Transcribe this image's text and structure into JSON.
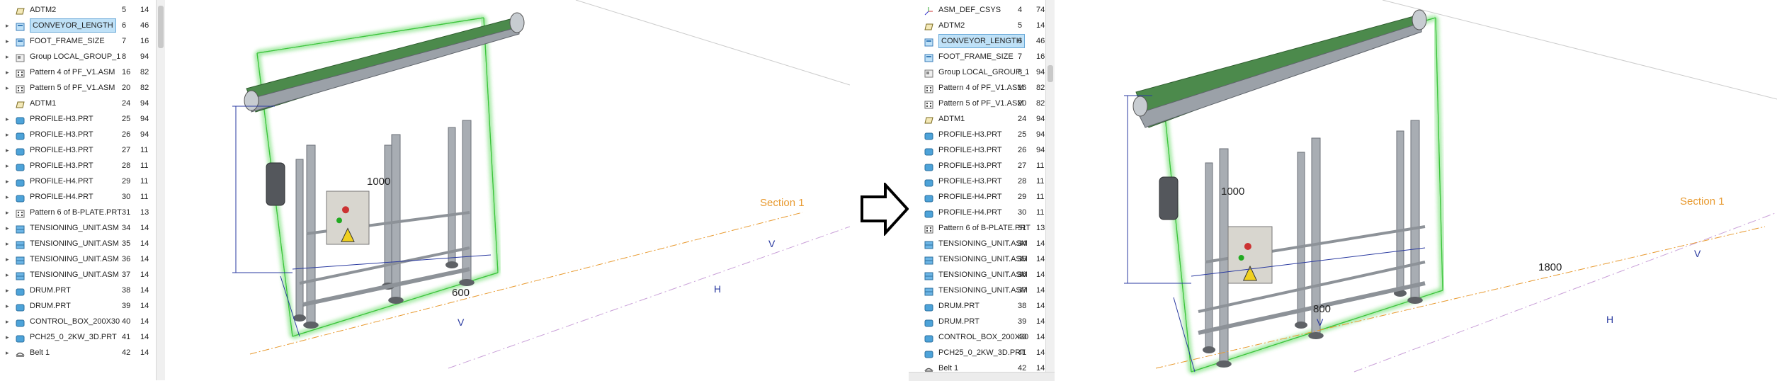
{
  "left_tree": {
    "rows": [
      {
        "name": "ADTM2",
        "id": "5",
        "val": "14",
        "icon": "datum-plane-icon",
        "exp": ""
      },
      {
        "name": "CONVEYOR_LENGTH",
        "id": "6",
        "val": "46",
        "icon": "parameter-icon",
        "exp": "▸",
        "selected": true
      },
      {
        "name": "FOOT_FRAME_SIZE",
        "id": "7",
        "val": "16",
        "icon": "parameter-icon",
        "exp": "▸"
      },
      {
        "name": "Group LOCAL_GROUP_1",
        "id": "8",
        "val": "94",
        "icon": "group-icon",
        "exp": "▸"
      },
      {
        "name": "Pattern 4 of PF_V1.ASM",
        "id": "16",
        "val": "82",
        "icon": "pattern-icon",
        "exp": "▸"
      },
      {
        "name": "Pattern 5 of PF_V1.ASM",
        "id": "20",
        "val": "82",
        "icon": "pattern-icon",
        "exp": "▸"
      },
      {
        "name": "ADTM1",
        "id": "24",
        "val": "94",
        "icon": "datum-plane-icon",
        "exp": ""
      },
      {
        "name": "PROFILE-H3.PRT",
        "id": "25",
        "val": "94",
        "icon": "part-icon",
        "exp": "▸"
      },
      {
        "name": "PROFILE-H3.PRT",
        "id": "26",
        "val": "94",
        "icon": "part-icon",
        "exp": "▸"
      },
      {
        "name": "PROFILE-H3.PRT",
        "id": "27",
        "val": "11",
        "icon": "part-icon",
        "exp": "▸"
      },
      {
        "name": "PROFILE-H3.PRT",
        "id": "28",
        "val": "11",
        "icon": "part-icon",
        "exp": "▸"
      },
      {
        "name": "PROFILE-H4.PRT",
        "id": "29",
        "val": "11",
        "icon": "part-icon",
        "exp": "▸"
      },
      {
        "name": "PROFILE-H4.PRT",
        "id": "30",
        "val": "11",
        "icon": "part-icon",
        "exp": "▸"
      },
      {
        "name": "Pattern 6 of B-PLATE.PRT",
        "id": "31",
        "val": "13",
        "icon": "pattern-icon",
        "exp": "▸"
      },
      {
        "name": "TENSIONING_UNIT.ASM",
        "id": "34",
        "val": "14",
        "icon": "assembly-icon",
        "exp": "▸"
      },
      {
        "name": "TENSIONING_UNIT.ASM",
        "id": "35",
        "val": "14",
        "icon": "assembly-icon",
        "exp": "▸"
      },
      {
        "name": "TENSIONING_UNIT.ASM",
        "id": "36",
        "val": "14",
        "icon": "assembly-icon",
        "exp": "▸"
      },
      {
        "name": "TENSIONING_UNIT.ASM",
        "id": "37",
        "val": "14",
        "icon": "assembly-icon",
        "exp": "▸"
      },
      {
        "name": "DRUM.PRT",
        "id": "38",
        "val": "14",
        "icon": "part-icon",
        "exp": "▸"
      },
      {
        "name": "DRUM.PRT",
        "id": "39",
        "val": "14",
        "icon": "part-icon",
        "exp": "▸"
      },
      {
        "name": "CONTROL_BOX_200X30",
        "id": "40",
        "val": "14",
        "icon": "part-icon",
        "exp": "▸"
      },
      {
        "name": "PCH25_0_2KW_3D.PRT",
        "id": "41",
        "val": "14",
        "icon": "part-icon",
        "exp": "▸"
      },
      {
        "name": "Belt 1",
        "id": "42",
        "val": "14",
        "icon": "belt-icon",
        "exp": "▸"
      }
    ]
  },
  "right_tree": {
    "rows": [
      {
        "name": "ASM_DEF_CSYS",
        "id": "4",
        "val": "74",
        "icon": "csys-icon",
        "exp": ""
      },
      {
        "name": "ADTM2",
        "id": "5",
        "val": "14",
        "icon": "datum-plane-icon",
        "exp": ""
      },
      {
        "name": "CONVEYOR_LENGTH",
        "id": "6",
        "val": "46",
        "icon": "parameter-icon",
        "exp": "",
        "selected": true
      },
      {
        "name": "FOOT_FRAME_SIZE",
        "id": "7",
        "val": "16",
        "icon": "parameter-icon",
        "exp": ""
      },
      {
        "name": "Group LOCAL_GROUP_1",
        "id": "8",
        "val": "94",
        "icon": "group-icon",
        "exp": ""
      },
      {
        "name": "Pattern 4 of PF_V1.ASM",
        "id": "16",
        "val": "82",
        "icon": "pattern-icon",
        "exp": ""
      },
      {
        "name": "Pattern 5 of PF_V1.ASM",
        "id": "20",
        "val": "82",
        "icon": "pattern-icon",
        "exp": ""
      },
      {
        "name": "ADTM1",
        "id": "24",
        "val": "94",
        "icon": "datum-plane-icon",
        "exp": ""
      },
      {
        "name": "PROFILE-H3.PRT",
        "id": "25",
        "val": "94",
        "icon": "part-icon",
        "exp": ""
      },
      {
        "name": "PROFILE-H3.PRT",
        "id": "26",
        "val": "94",
        "icon": "part-icon",
        "exp": ""
      },
      {
        "name": "PROFILE-H3.PRT",
        "id": "27",
        "val": "11",
        "icon": "part-icon",
        "exp": ""
      },
      {
        "name": "PROFILE-H3.PRT",
        "id": "28",
        "val": "11",
        "icon": "part-icon",
        "exp": ""
      },
      {
        "name": "PROFILE-H4.PRT",
        "id": "29",
        "val": "11",
        "icon": "part-icon",
        "exp": ""
      },
      {
        "name": "PROFILE-H4.PRT",
        "id": "30",
        "val": "11",
        "icon": "part-icon",
        "exp": ""
      },
      {
        "name": "Pattern 6 of B-PLATE.PRT",
        "id": "31",
        "val": "13",
        "icon": "pattern-icon",
        "exp": ""
      },
      {
        "name": "TENSIONING_UNIT.ASM",
        "id": "34",
        "val": "14",
        "icon": "assembly-icon",
        "exp": ""
      },
      {
        "name": "TENSIONING_UNIT.ASM",
        "id": "35",
        "val": "14",
        "icon": "assembly-icon",
        "exp": ""
      },
      {
        "name": "TENSIONING_UNIT.ASM",
        "id": "36",
        "val": "14",
        "icon": "assembly-icon",
        "exp": ""
      },
      {
        "name": "TENSIONING_UNIT.ASM",
        "id": "37",
        "val": "14",
        "icon": "assembly-icon",
        "exp": ""
      },
      {
        "name": "DRUM.PRT",
        "id": "38",
        "val": "14",
        "icon": "part-icon",
        "exp": ""
      },
      {
        "name": "DRUM.PRT",
        "id": "39",
        "val": "14",
        "icon": "part-icon",
        "exp": ""
      },
      {
        "name": "CONTROL_BOX_200X30",
        "id": "40",
        "val": "14",
        "icon": "part-icon",
        "exp": ""
      },
      {
        "name": "PCH25_0_2KW_3D.PRT",
        "id": "41",
        "val": "14",
        "icon": "part-icon",
        "exp": ""
      },
      {
        "name": "Belt 1",
        "id": "42",
        "val": "14",
        "icon": "belt-icon",
        "exp": ""
      }
    ]
  },
  "left_view": {
    "height_dim": "1000",
    "width_dim": "600",
    "length_dim": "",
    "section_label": "Section 1",
    "axis_v": "V",
    "axis_h": "H",
    "axis_v2": "V"
  },
  "right_view": {
    "height_dim": "1000",
    "width_dim": "800",
    "length_dim": "1800",
    "section_label": "Section 1",
    "axis_v": "V",
    "axis_h": "H",
    "axis_v2": "V"
  },
  "colors": {
    "belt": "#4c8a4c",
    "frame": "#a8adb3",
    "glow": "#7be07b",
    "dim_line": "#2a3aa0",
    "section": "#e89a30",
    "selection": "#bfe1f7"
  }
}
